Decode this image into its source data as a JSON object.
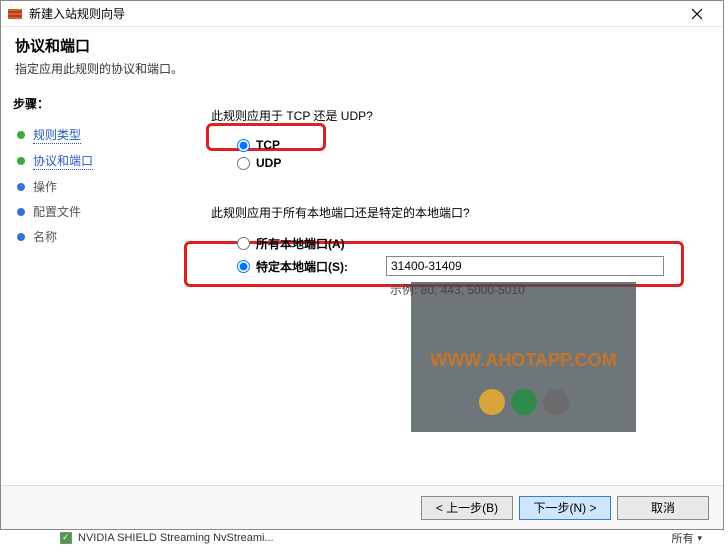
{
  "title": "新建入站规则向导",
  "header": {
    "title": "协议和端口",
    "desc": "指定应用此规则的协议和端口。"
  },
  "sidebar": {
    "title": "步骤：",
    "steps": [
      {
        "label": "规则类型",
        "link": true,
        "bullet": "green"
      },
      {
        "label": "协议和端口",
        "link": true,
        "bullet": "green"
      },
      {
        "label": "操作",
        "link": false,
        "bullet": "blue"
      },
      {
        "label": "配置文件",
        "link": false,
        "bullet": "blue"
      },
      {
        "label": "名称",
        "link": false,
        "bullet": "blue"
      }
    ]
  },
  "main": {
    "protocolQuestion": "此规则应用于 TCP 还是 UDP?",
    "protocol": {
      "tcp": {
        "label": "TCP",
        "checked": true
      },
      "udp": {
        "label": "UDP",
        "checked": false
      }
    },
    "portQuestion": "此规则应用于所有本地端口还是特定的本地端口?",
    "ports": {
      "all": {
        "label": "所有本地端口(A)",
        "checked": false
      },
      "specific": {
        "label": "特定本地端口(S):",
        "checked": true,
        "value": "31400-31409"
      },
      "example": "示例: 80, 443, 5000-5010"
    }
  },
  "footer": {
    "back": "< 上一步(B)",
    "next": "下一步(N) >",
    "cancel": "取消"
  },
  "below": {
    "leftText": "NVIDIA SHIELD Streaming NvStreami...",
    "rightText": "所有"
  },
  "watermark": {
    "text": "WWW.AHOTAPP.COM"
  }
}
